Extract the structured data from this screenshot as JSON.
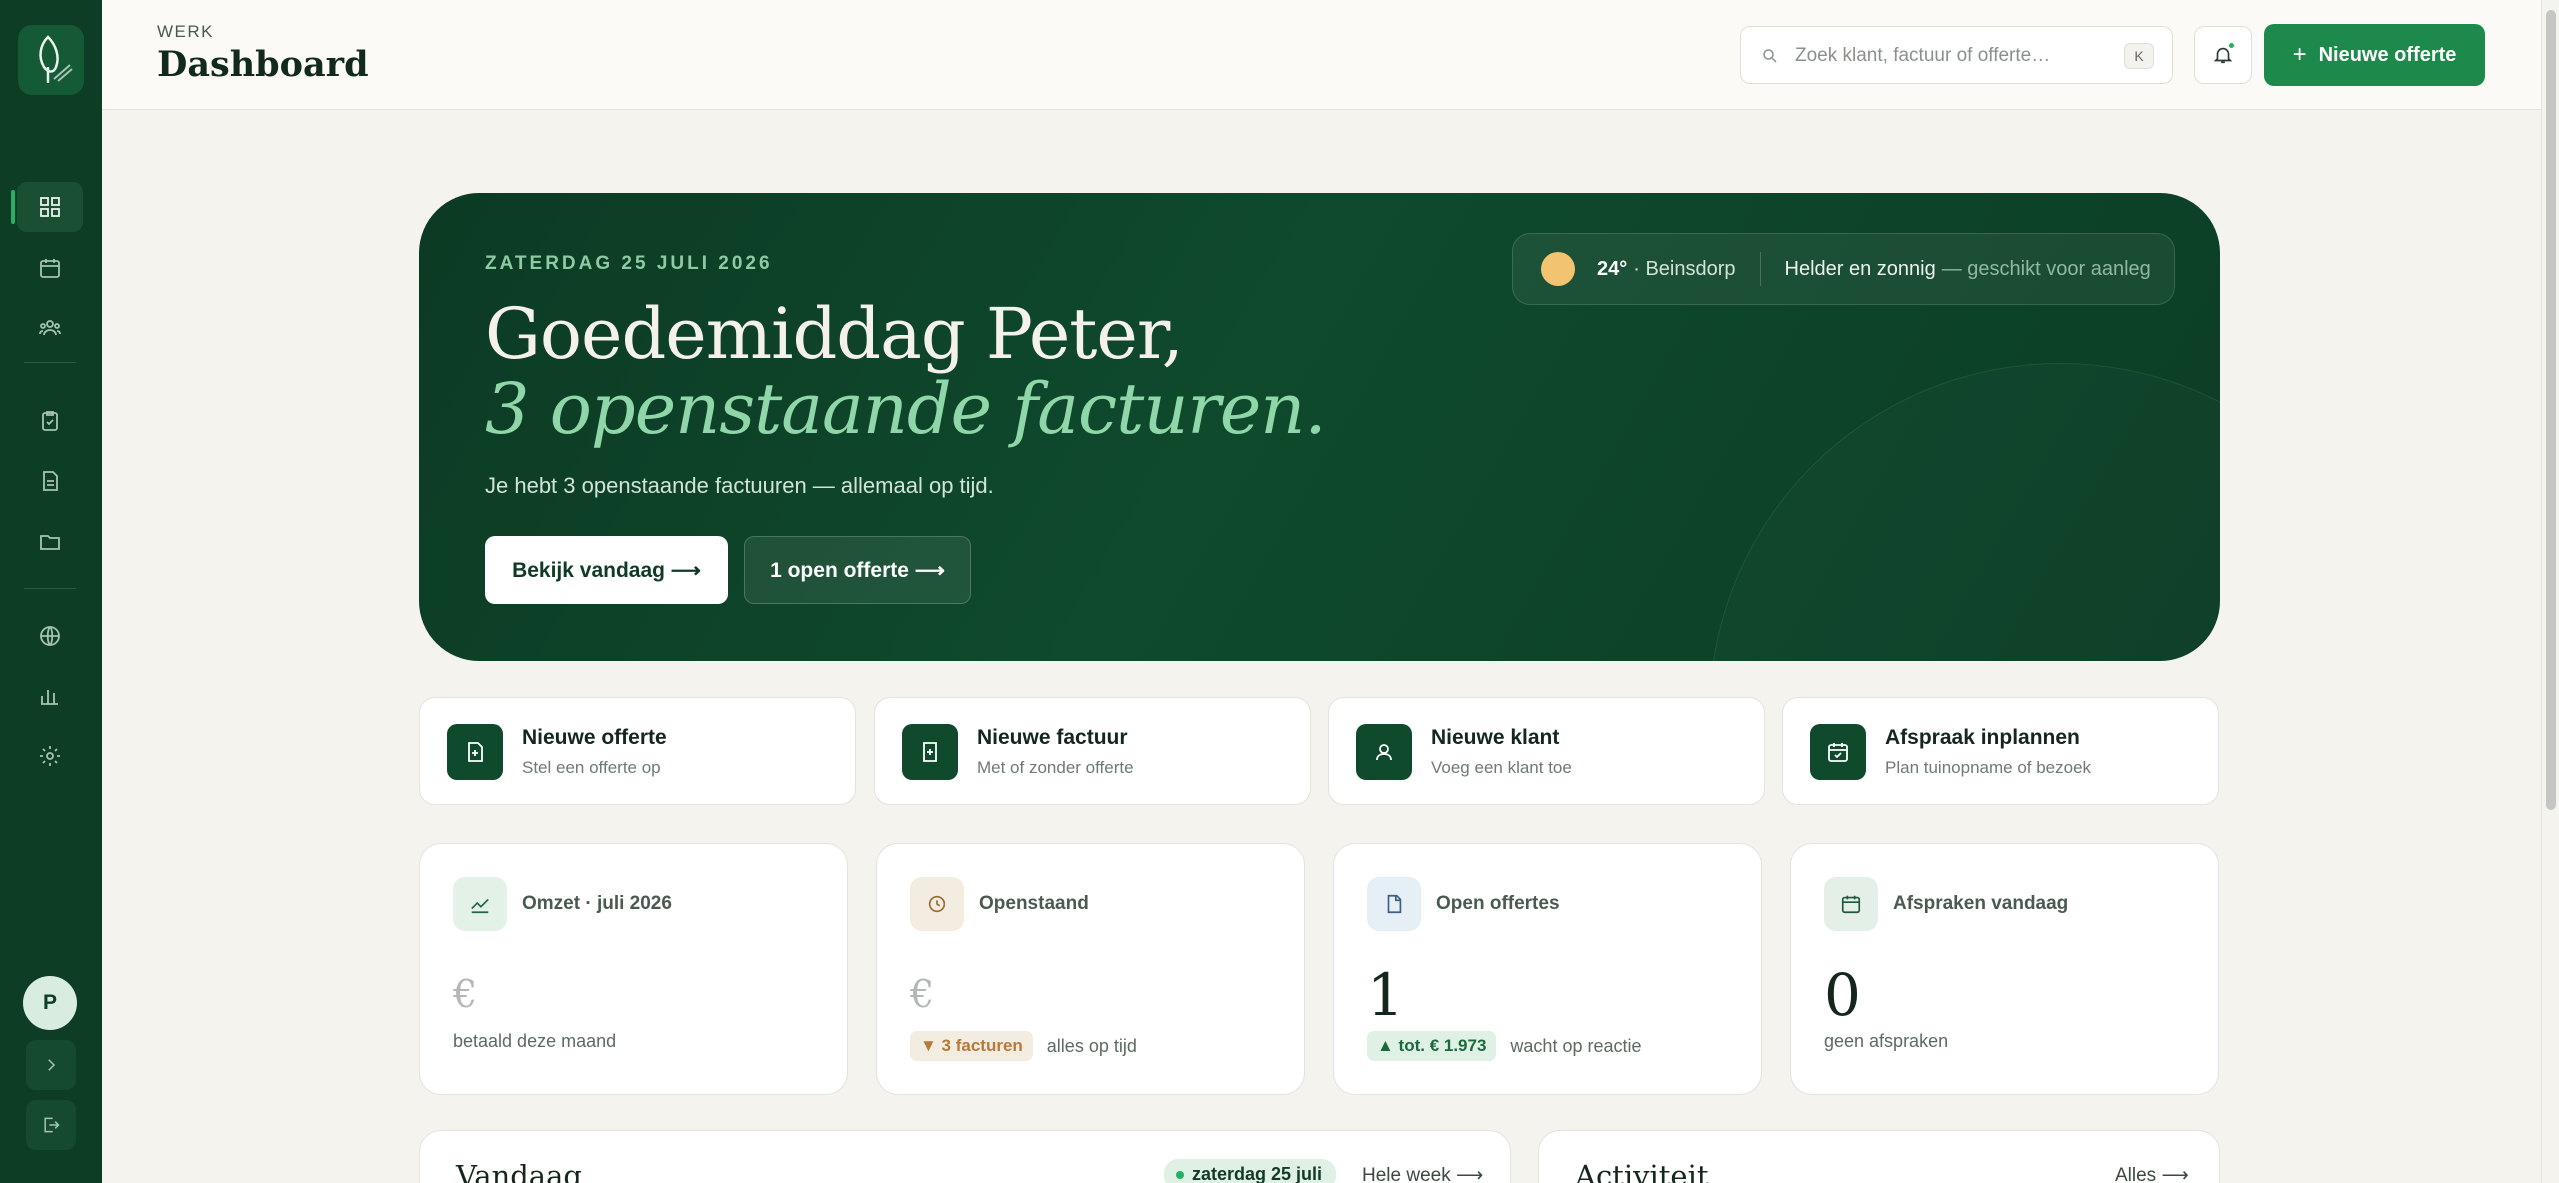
{
  "header": {
    "crumb": "WERK",
    "title": "Dashboard",
    "search_placeholder": "Zoek klant, factuur of offerte…",
    "search_kbd": "K",
    "new_button": "Nieuwe offerte"
  },
  "sidebar": {
    "avatar_initial": "P",
    "items": [
      "dashboard",
      "agenda",
      "klanten",
      "offertes",
      "facturen",
      "bestanden",
      "website",
      "rapporten",
      "instellingen"
    ],
    "active": "dashboard"
  },
  "hero": {
    "date": "ZATERDAG 25 JULI 2026",
    "greeting": "Goedemiddag Peter,",
    "highlight": "3 openstaande facturen.",
    "subtitle": "Je hebt 3 openstaande factuuren — allemaal op tijd.",
    "primary_button": "Bekijk vandaag ⟶",
    "secondary_button": "1 open offerte ⟶",
    "weather": {
      "temp": "24°",
      "location": "· Beinsdorp",
      "condition": "Helder en zonnig",
      "note": "— geschikt voor aanleg"
    }
  },
  "quick_actions": [
    {
      "title": "Nieuwe offerte",
      "subtitle": "Stel een offerte op",
      "icon": "document-plus-icon"
    },
    {
      "title": "Nieuwe factuur",
      "subtitle": "Met of zonder offerte",
      "icon": "invoice-plus-icon"
    },
    {
      "title": "Nieuwe klant",
      "subtitle": "Voeg een klant toe",
      "icon": "user-icon"
    },
    {
      "title": "Afspraak inplannen",
      "subtitle": "Plan tuinopname of bezoek",
      "icon": "calendar-check-icon"
    }
  ],
  "stats": [
    {
      "title": "Omzet · juli 2026",
      "value": "€",
      "footer": "betaald deze maand",
      "pill": ""
    },
    {
      "title": "Openstaand",
      "value": "€",
      "footer": "alles op tijd",
      "pill": "▼ 3 facturen"
    },
    {
      "title": "Open offertes",
      "value": "1",
      "footer": "wacht op reactie",
      "pill": "▲ tot. € 1.973"
    },
    {
      "title": "Afspraken vandaag",
      "value": "0",
      "footer": "geen afspraken",
      "pill": ""
    }
  ],
  "today_panel": {
    "title": "Vandaag",
    "date_pill": "zaterdag 25 juli",
    "link": "Hele week ⟶"
  },
  "activity_panel": {
    "title": "Activiteit",
    "link": "Alles ⟶"
  },
  "colors": {
    "brand_dark": "#0e3d26",
    "accent": "#1d8a4c",
    "highlight": "#8fd6a8"
  }
}
